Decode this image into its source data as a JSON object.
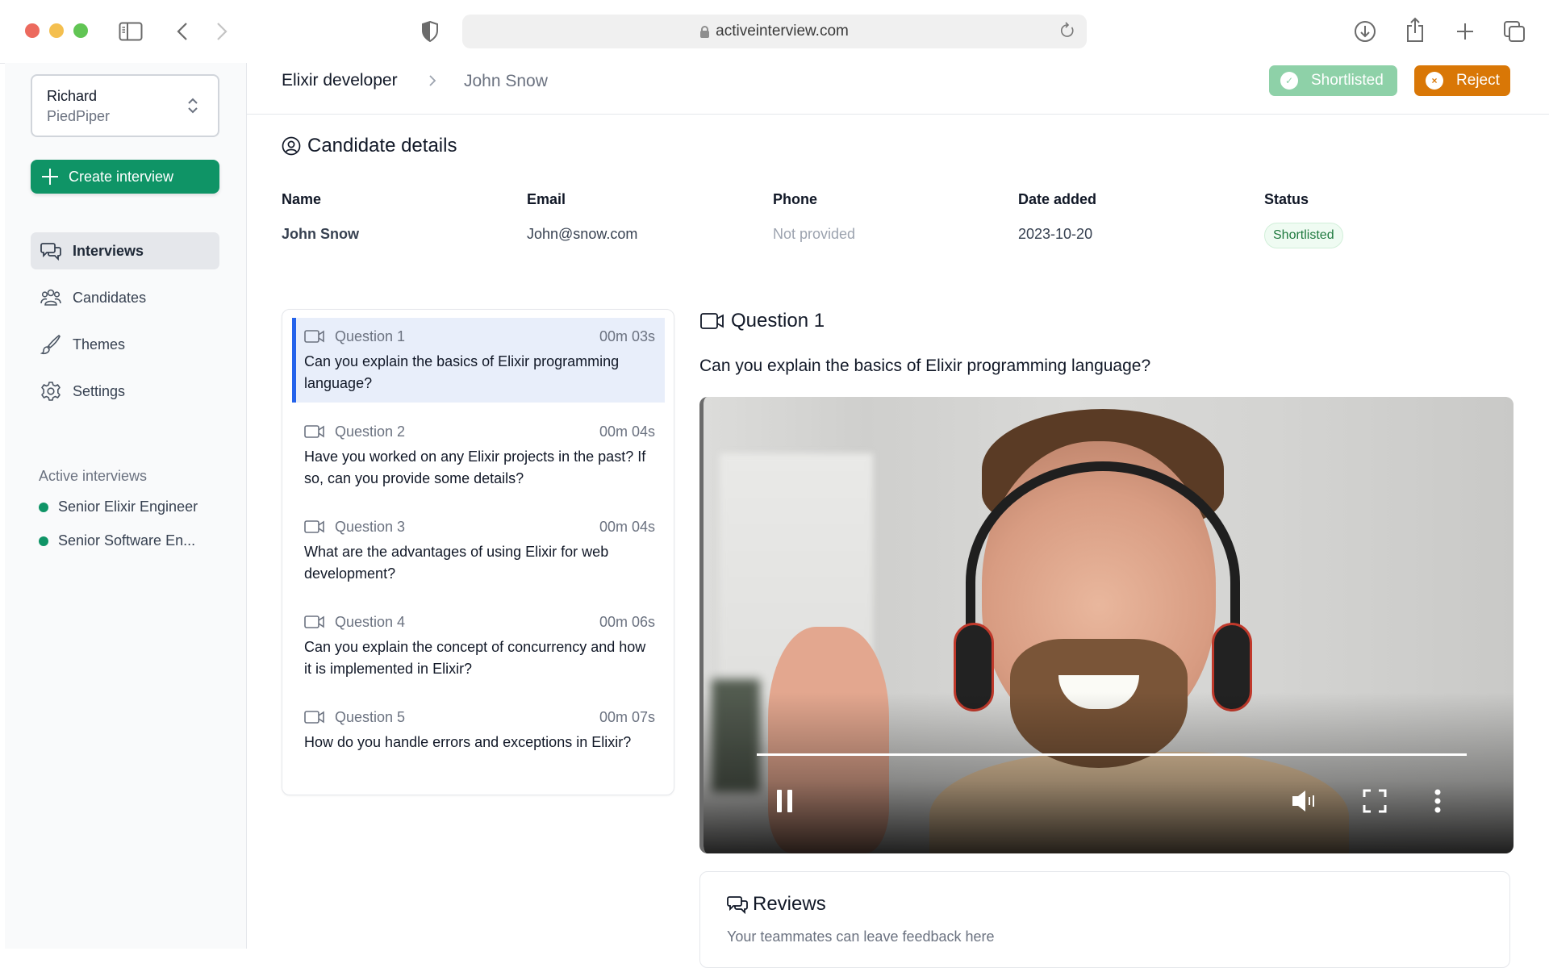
{
  "browser": {
    "url": "activeinterview.com",
    "icons": [
      "sidebar-toggle-icon",
      "back-icon",
      "forward-icon",
      "privacy-shield-icon",
      "lock-icon",
      "reload-icon",
      "download-icon",
      "share-icon",
      "new-tab-icon",
      "tab-overview-icon"
    ]
  },
  "sidebar": {
    "org": {
      "user": "Richard",
      "company": "PiedPiper"
    },
    "create_label": "Create interview",
    "nav": [
      {
        "label": "Interviews",
        "icon": "chat-bubbles-icon",
        "active": true
      },
      {
        "label": "Candidates",
        "icon": "users-icon",
        "active": false
      },
      {
        "label": "Themes",
        "icon": "paintbrush-icon",
        "active": false
      },
      {
        "label": "Settings",
        "icon": "gear-icon",
        "active": false
      }
    ],
    "active_interviews_label": "Active interviews",
    "active_interviews": [
      {
        "label": "Senior Elixir Engineer",
        "status_color": "#0f9466"
      },
      {
        "label": "Senior Software En...",
        "status_color": "#0f9466"
      }
    ]
  },
  "header": {
    "breadcrumb": [
      "Elixir developer",
      "John Snow"
    ],
    "shortlisted_label": "Shortlisted",
    "reject_label": "Reject"
  },
  "candidate": {
    "title": "Candidate details",
    "columns": [
      "Name",
      "Email",
      "Phone",
      "Date added",
      "Status"
    ],
    "values": {
      "name": "John Snow",
      "email": "John@snow.com",
      "phone": "Not provided",
      "date_added": "2023-10-20",
      "status": "Shortlisted"
    }
  },
  "questions": [
    {
      "label": "Question 1",
      "duration": "00m 03s",
      "text": "Can you explain the basics of Elixir programming language?",
      "selected": true
    },
    {
      "label": "Question 2",
      "duration": "00m 04s",
      "text": "Have you worked on any Elixir projects in the past? If so, can you provide some details?",
      "selected": false
    },
    {
      "label": "Question 3",
      "duration": "00m 04s",
      "text": "What are the advantages of using Elixir for web development?",
      "selected": false
    },
    {
      "label": "Question 4",
      "duration": "00m 06s",
      "text": "Can you explain the concept of concurrency and how it is implemented in Elixir?",
      "selected": false
    },
    {
      "label": "Question 5",
      "duration": "00m 07s",
      "text": "How do you handle errors and exceptions in Elixir?",
      "selected": false
    }
  ],
  "detail": {
    "title": "Question 1",
    "text": "Can you explain the basics of Elixir programming language?",
    "video": {
      "progress_percent": 100,
      "state": "playing",
      "controls": [
        "pause-icon",
        "volume-icon",
        "fullscreen-icon",
        "more-options-icon"
      ]
    }
  },
  "reviews": {
    "title": "Reviews",
    "subtitle": "Your teammates can leave feedback here"
  },
  "colors": {
    "brand_green": "#0f9466",
    "shortlisted_button": "#8ed1a8",
    "reject_button": "#d97706",
    "selected_accent": "#2563eb"
  }
}
